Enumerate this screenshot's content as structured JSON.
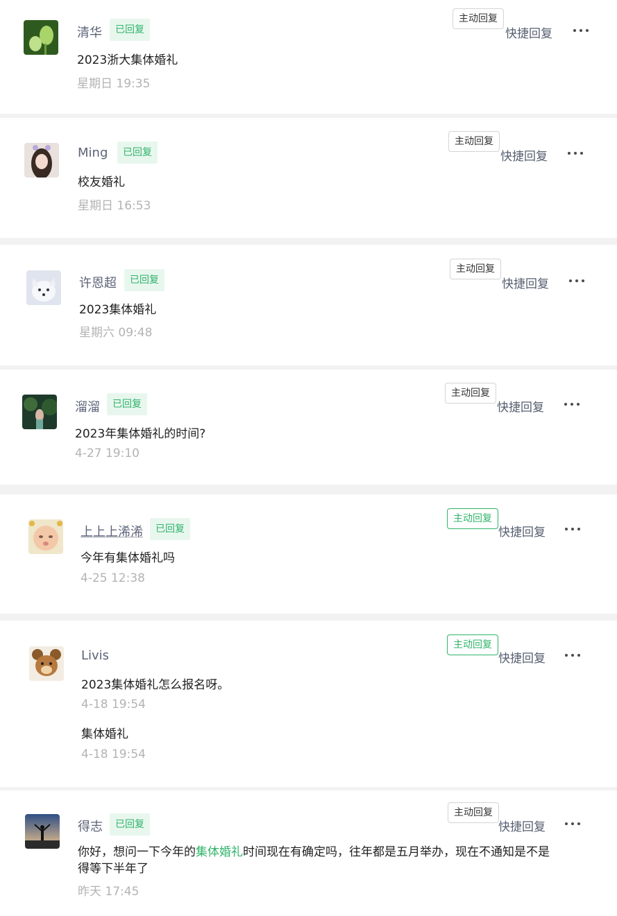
{
  "conversations": [
    {
      "name": "清华",
      "badge": "已回复",
      "messages": [
        {
          "text": "2023浙大集体婚礼",
          "time": "星期日 19:35"
        }
      ],
      "active_reply": "主动回复",
      "quick_reply": "快捷回复"
    },
    {
      "name": "Ming",
      "badge": "已回复",
      "messages": [
        {
          "text": "校友婚礼",
          "time": "星期日 16:53"
        }
      ],
      "active_reply": "主动回复",
      "quick_reply": "快捷回复"
    },
    {
      "name": "许恩超",
      "badge": "已回复",
      "messages": [
        {
          "text": "2023集体婚礼",
          "time": "星期六 09:48"
        }
      ],
      "active_reply": "主动回复",
      "quick_reply": "快捷回复"
    },
    {
      "name": "溜溜",
      "badge": "已回复",
      "messages": [
        {
          "text": "2023年集体婚礼的时间?",
          "time": "4-27 19:10"
        }
      ],
      "active_reply": "主动回复",
      "quick_reply": "快捷回复"
    },
    {
      "name": "上上上浠浠",
      "badge": "已回复",
      "messages": [
        {
          "text": "今年有集体婚礼吗",
          "time": "4-25 12:38"
        }
      ],
      "active_reply": "主动回复",
      "quick_reply": "快捷回复"
    },
    {
      "name": "Livis",
      "badge": "",
      "messages": [
        {
          "text": "2023集体婚礼怎么报名呀。",
          "time": "4-18 19:54"
        },
        {
          "text": "集体婚礼",
          "time": "4-18 19:54"
        }
      ],
      "active_reply": "主动回复",
      "quick_reply": "快捷回复"
    },
    {
      "name": "得志",
      "badge": "已回复",
      "messages": [
        {
          "text_before": "你好，想问一下今年的",
          "highlight": "集体婚礼",
          "text_after": "时间现在有确定吗，往年都是五月举办，现在不通知是不是得等下半年了",
          "time": "昨天 17:45"
        }
      ],
      "active_reply": "主动回复",
      "quick_reply": "快捷回复"
    }
  ],
  "colors": {
    "badge_text": "#2fb36a",
    "badge_bg": "#e8f7ee",
    "highlight": "#2fb36a",
    "time": "#b3b3b3"
  },
  "icons": {
    "more": "more-dots-icon"
  }
}
